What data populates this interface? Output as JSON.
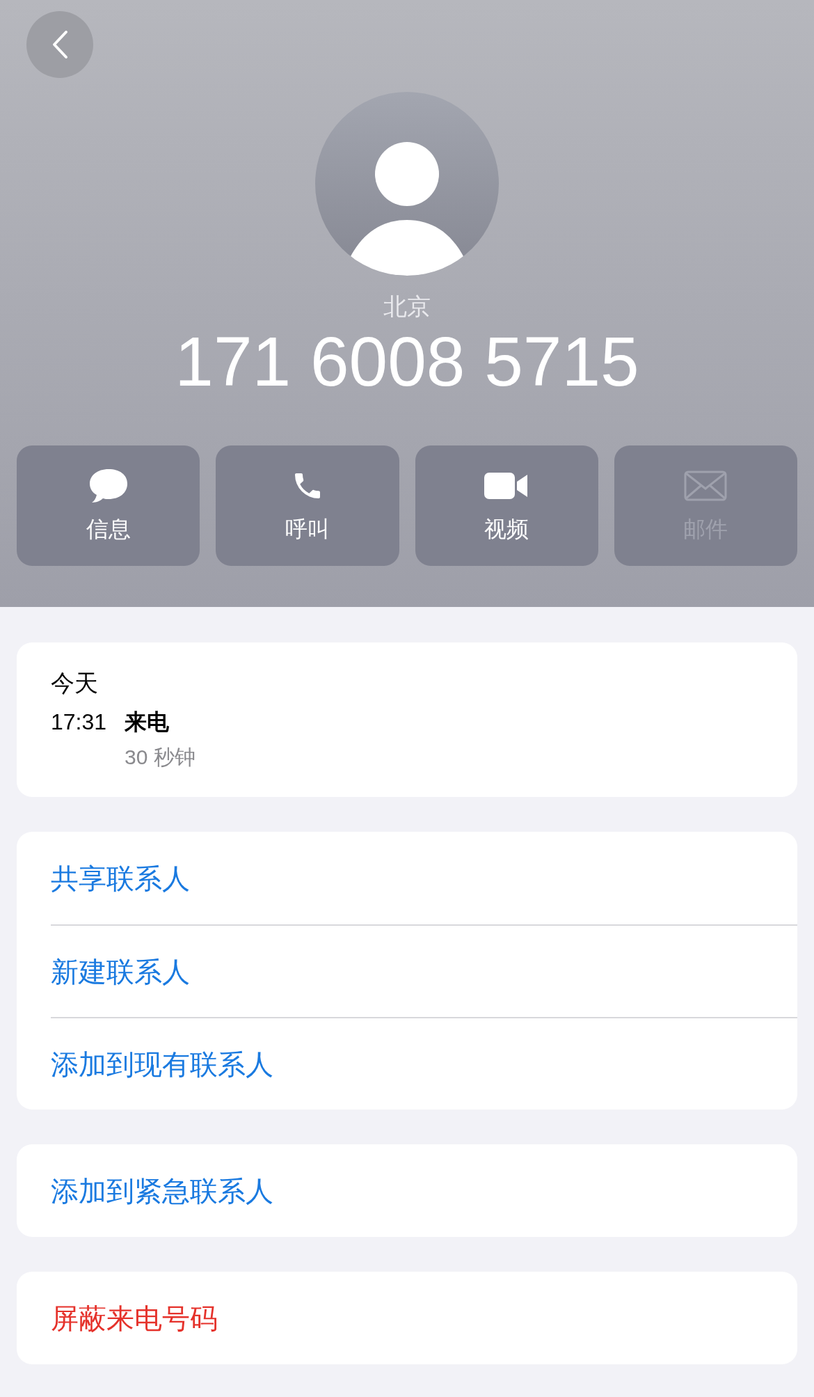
{
  "header": {
    "location": "北京",
    "number": "171 6008 5715"
  },
  "actions": [
    {
      "kind": "message",
      "label": "信息",
      "disabled": false
    },
    {
      "kind": "phone",
      "label": "呼叫",
      "disabled": false
    },
    {
      "kind": "video",
      "label": "视频",
      "disabled": false
    },
    {
      "kind": "mail",
      "label": "邮件",
      "disabled": true
    }
  ],
  "call_history": {
    "day": "今天",
    "calls": [
      {
        "time": "17:31",
        "type": "来电",
        "duration": "30 秒钟"
      }
    ]
  },
  "groups": [
    [
      {
        "label": "共享联系人",
        "kind": "normal"
      },
      {
        "label": "新建联系人",
        "kind": "normal"
      },
      {
        "label": "添加到现有联系人",
        "kind": "normal"
      }
    ],
    [
      {
        "label": "添加到紧急联系人",
        "kind": "normal"
      }
    ],
    [
      {
        "label": "屏蔽来电号码",
        "kind": "destructive"
      }
    ]
  ]
}
